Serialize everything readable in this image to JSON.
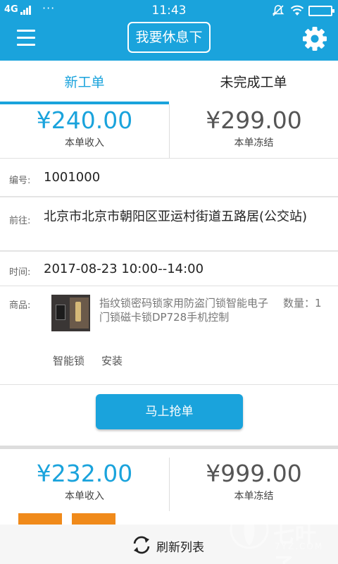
{
  "status_bar": {
    "network": "4G",
    "dots": "···",
    "time": "11:43"
  },
  "app_bar": {
    "rest_button": "我要休息下"
  },
  "tabs": [
    {
      "label": "新工单",
      "active": true
    },
    {
      "label": "未完成工单",
      "active": false
    }
  ],
  "colors": {
    "primary": "#1aa3dc",
    "tag_orange": "#f08a1a"
  },
  "orders": [
    {
      "income": "¥240.00",
      "income_label": "本单收入",
      "frozen": "¥299.00",
      "frozen_label": "本单冻结",
      "number_label": "编号:",
      "number": "1001000",
      "destination_label": "前往:",
      "destination": "北京市北京市朝阳区亚运村街道五路居(公交站)",
      "time_label": "时间:",
      "time": "2017-08-23 10:00--14:00",
      "goods_label": "商品:",
      "goods_name": "指纹锁密码锁家用防盗门锁智能电子门锁磁卡锁DP728手机控制",
      "quantity": "数量：1",
      "tags": [
        "智能锁",
        "安装"
      ],
      "grab_button": "马上抢单"
    },
    {
      "income": "¥232.00",
      "income_label": "本单收入",
      "frozen": "¥999.00",
      "frozen_label": "本单冻结"
    }
  ],
  "refresh": {
    "label": "刷新列表",
    "icon": "refresh-icon"
  },
  "watermark": {
    "name": "七叶子",
    "url": "7YZ.COM"
  }
}
